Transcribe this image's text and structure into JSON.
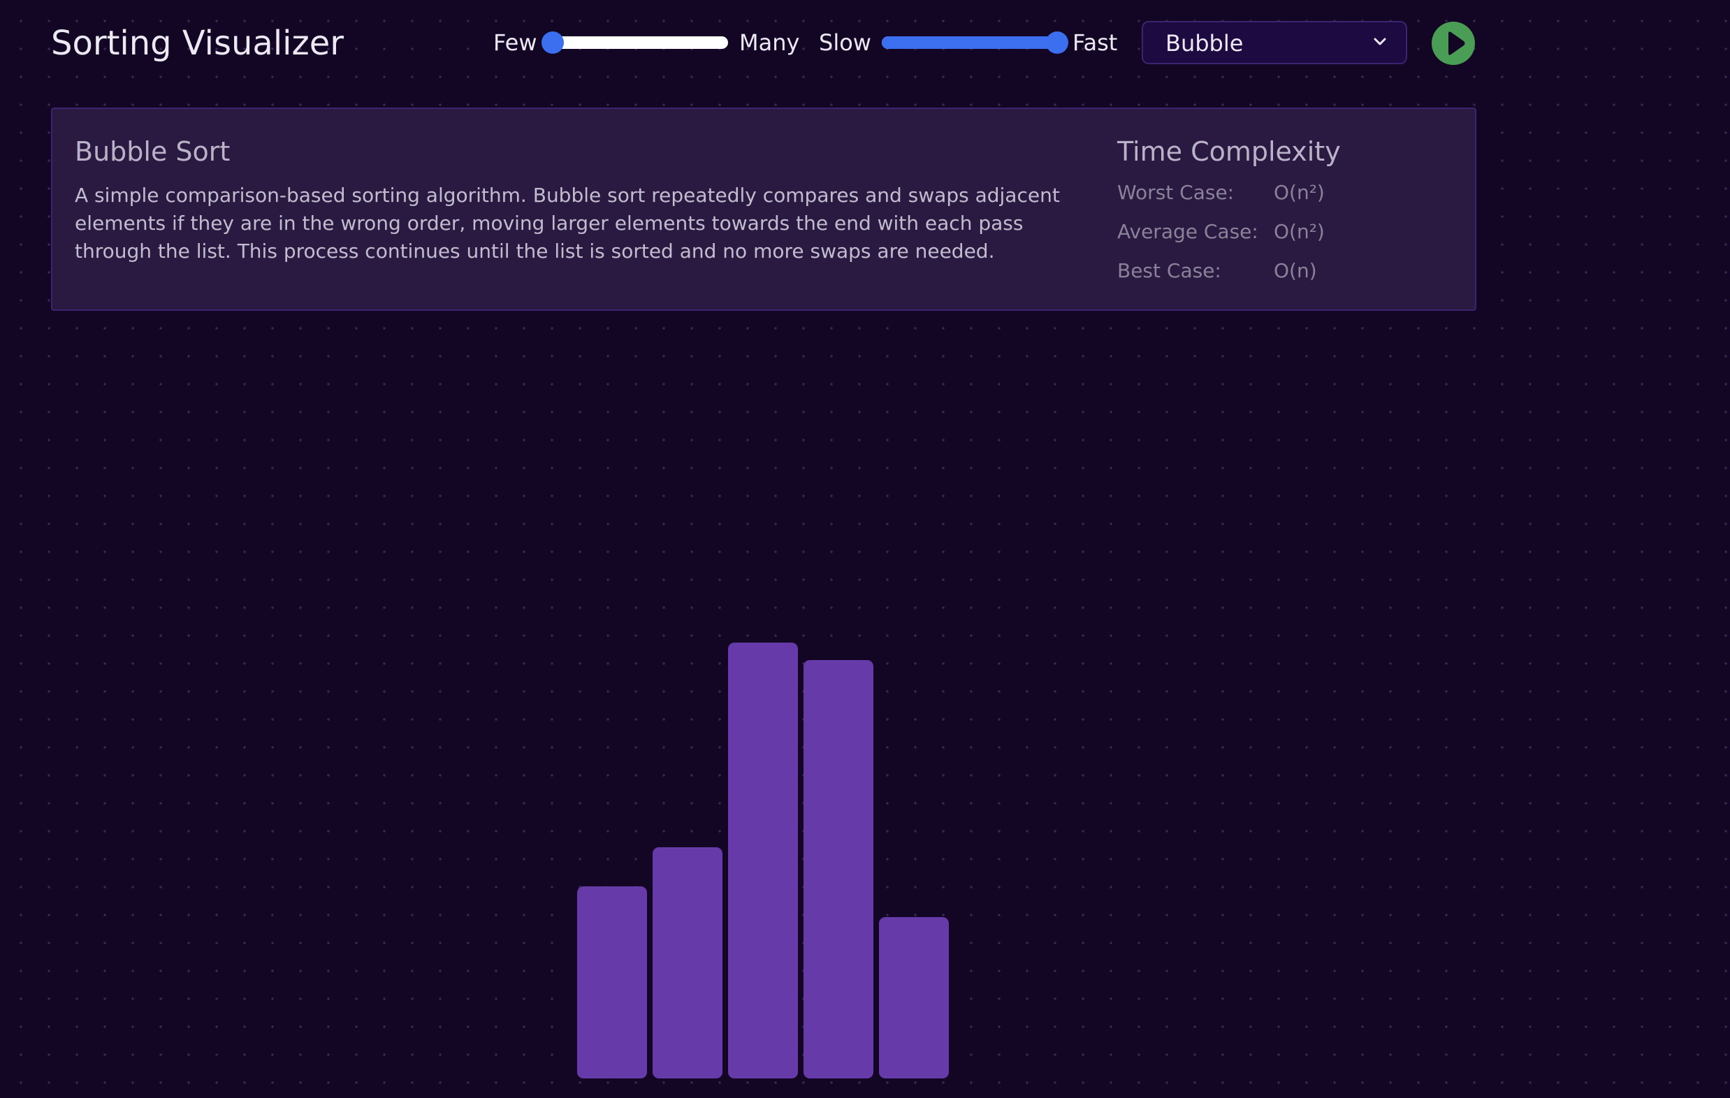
{
  "app": {
    "title": "Sorting Visualizer"
  },
  "controls": {
    "size": {
      "min_label": "Few",
      "max_label": "Many",
      "value_fraction": 0.02
    },
    "speed": {
      "min_label": "Slow",
      "max_label": "Fast",
      "value_fraction": 0.98
    },
    "algorithm_select": {
      "selected": "Bubble"
    },
    "play_icon": "play-icon"
  },
  "info": {
    "algorithm_name": "Bubble Sort",
    "description": "A simple comparison-based sorting algorithm. Bubble sort repeatedly compares and swaps adjacent elements if they are in the wrong order, moving larger elements towards the end with each pass through the list. This process continues until the list is sorted and no more swaps are needed.",
    "complexity_title": "Time Complexity",
    "complexity": [
      {
        "label": "Worst Case:",
        "value": "O(n²)"
      },
      {
        "label": "Average Case:",
        "value": "O(n²)"
      },
      {
        "label": "Best Case:",
        "value": "O(n)"
      }
    ]
  },
  "array": {
    "values": [
      44,
      53,
      100,
      96,
      37
    ],
    "max_value": 100
  },
  "colors": {
    "background": "#120624",
    "bar": "#663aa8",
    "slider_accent": "#3b6ff0",
    "play_button": "#4a9d55",
    "card_background": "#2a1a42"
  }
}
